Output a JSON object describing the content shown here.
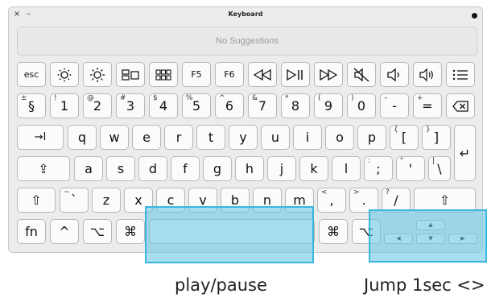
{
  "window": {
    "title": "Keyboard",
    "close": "×",
    "minimize": "–"
  },
  "suggestions": {
    "text": "No Suggestions"
  },
  "row1": {
    "esc": "esc",
    "f5": "F5",
    "f6": "F6"
  },
  "row2": {
    "keys": [
      {
        "shift": "±",
        "main": "§"
      },
      {
        "shift": "!",
        "main": "1"
      },
      {
        "shift": "@",
        "main": "2"
      },
      {
        "shift": "#",
        "main": "3"
      },
      {
        "shift": "$",
        "main": "4"
      },
      {
        "shift": "%",
        "main": "5"
      },
      {
        "shift": "^",
        "main": "6"
      },
      {
        "shift": "&",
        "main": "7"
      },
      {
        "shift": "*",
        "main": "8"
      },
      {
        "shift": "(",
        "main": "9"
      },
      {
        "shift": ")",
        "main": "0"
      },
      {
        "shift": "–",
        "main": "-"
      },
      {
        "shift": "+",
        "main": "="
      }
    ]
  },
  "row3": {
    "tab": "→I",
    "letters": [
      "q",
      "w",
      "e",
      "r",
      "t",
      "y",
      "u",
      "i",
      "o",
      "p"
    ],
    "brace_open": {
      "shift": "{",
      "main": "["
    },
    "brace_close": {
      "shift": "}",
      "main": "]"
    },
    "return": "↵"
  },
  "row4": {
    "caps": "⇪",
    "letters": [
      "a",
      "s",
      "d",
      "f",
      "g",
      "h",
      "j",
      "k",
      "l"
    ],
    "semi": {
      "shift": ":",
      "main": ";"
    },
    "quote": {
      "shift": "\"",
      "main": "'"
    },
    "pipe": {
      "shift": "|",
      "main": "\\"
    }
  },
  "row5": {
    "shift": "⇧",
    "tilde": {
      "shift": "~",
      "main": "`"
    },
    "letters": [
      "z",
      "x",
      "c",
      "v",
      "b",
      "n",
      "m"
    ],
    "lt": {
      "shift": "<",
      "main": ","
    },
    "gt": {
      "shift": ">",
      "main": "."
    },
    "q": {
      "shift": "?",
      "main": "/"
    },
    "shift_r": "⇧"
  },
  "row6": {
    "fn": "fn",
    "ctrl": "^",
    "opt": "⌥",
    "cmd": "⌘",
    "cmd_r": "⌘",
    "opt_r": "⌥",
    "up": "▲",
    "left": "◀",
    "down": "▼",
    "right": "▶"
  },
  "captions": {
    "space": "play/pause",
    "arrows": "Jump 1sec <>"
  },
  "colors": {
    "highlight": "#60c4e4",
    "highlight_border": "#39b6e0"
  }
}
